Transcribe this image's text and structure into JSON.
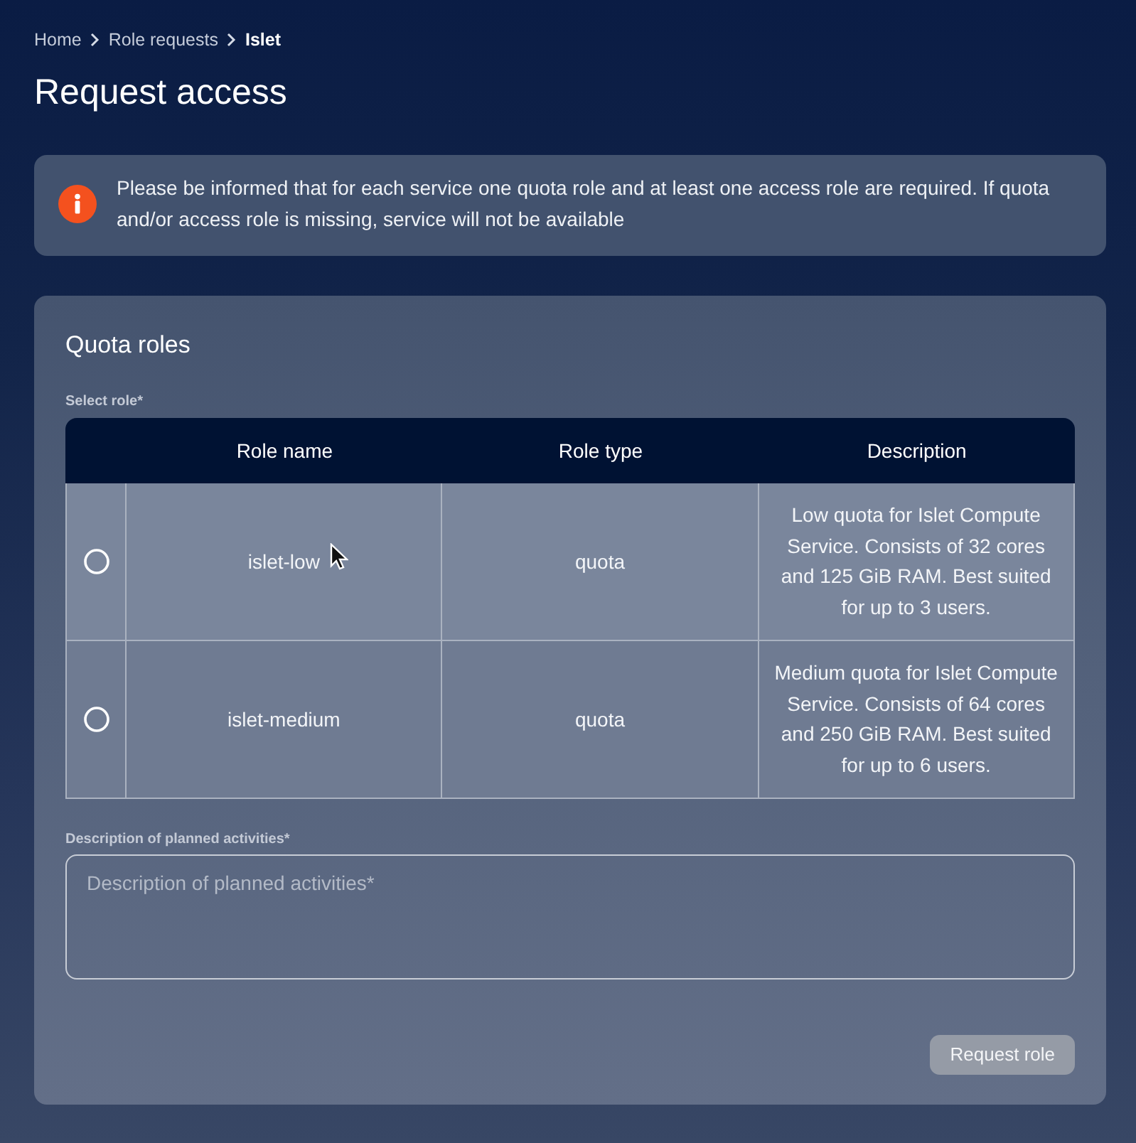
{
  "breadcrumb": [
    {
      "label": "Home",
      "current": false
    },
    {
      "label": "Role requests",
      "current": false
    },
    {
      "label": "Islet",
      "current": true
    }
  ],
  "title": "Request access",
  "alert": {
    "kind": "info",
    "text": "Please be informed that for each service one quota role and at least one access role are required. If quota and/or access role is missing, service will not be available"
  },
  "section": {
    "title": "Quota roles",
    "select_label": "Select role*",
    "table": {
      "columns": [
        "Role name",
        "Role type",
        "Description"
      ],
      "rows": [
        {
          "selected": false,
          "role_name": "islet-low",
          "role_type": "quota",
          "description": "Low quota for Islet Compute Service. Consists of 32 cores and 125 GiB RAM. Best suited for up to 3 users."
        },
        {
          "selected": false,
          "role_name": "islet-medium",
          "role_type": "quota",
          "description": "Medium quota for Islet Compute Service. Consists of 64 cores and 250 GiB RAM. Best suited for up to 6 users."
        }
      ]
    }
  },
  "description_field": {
    "label": "Description of planned activities*",
    "placeholder": "Description of planned activities*"
  },
  "submit_button": {
    "label": "Request role",
    "disabled": true
  }
}
